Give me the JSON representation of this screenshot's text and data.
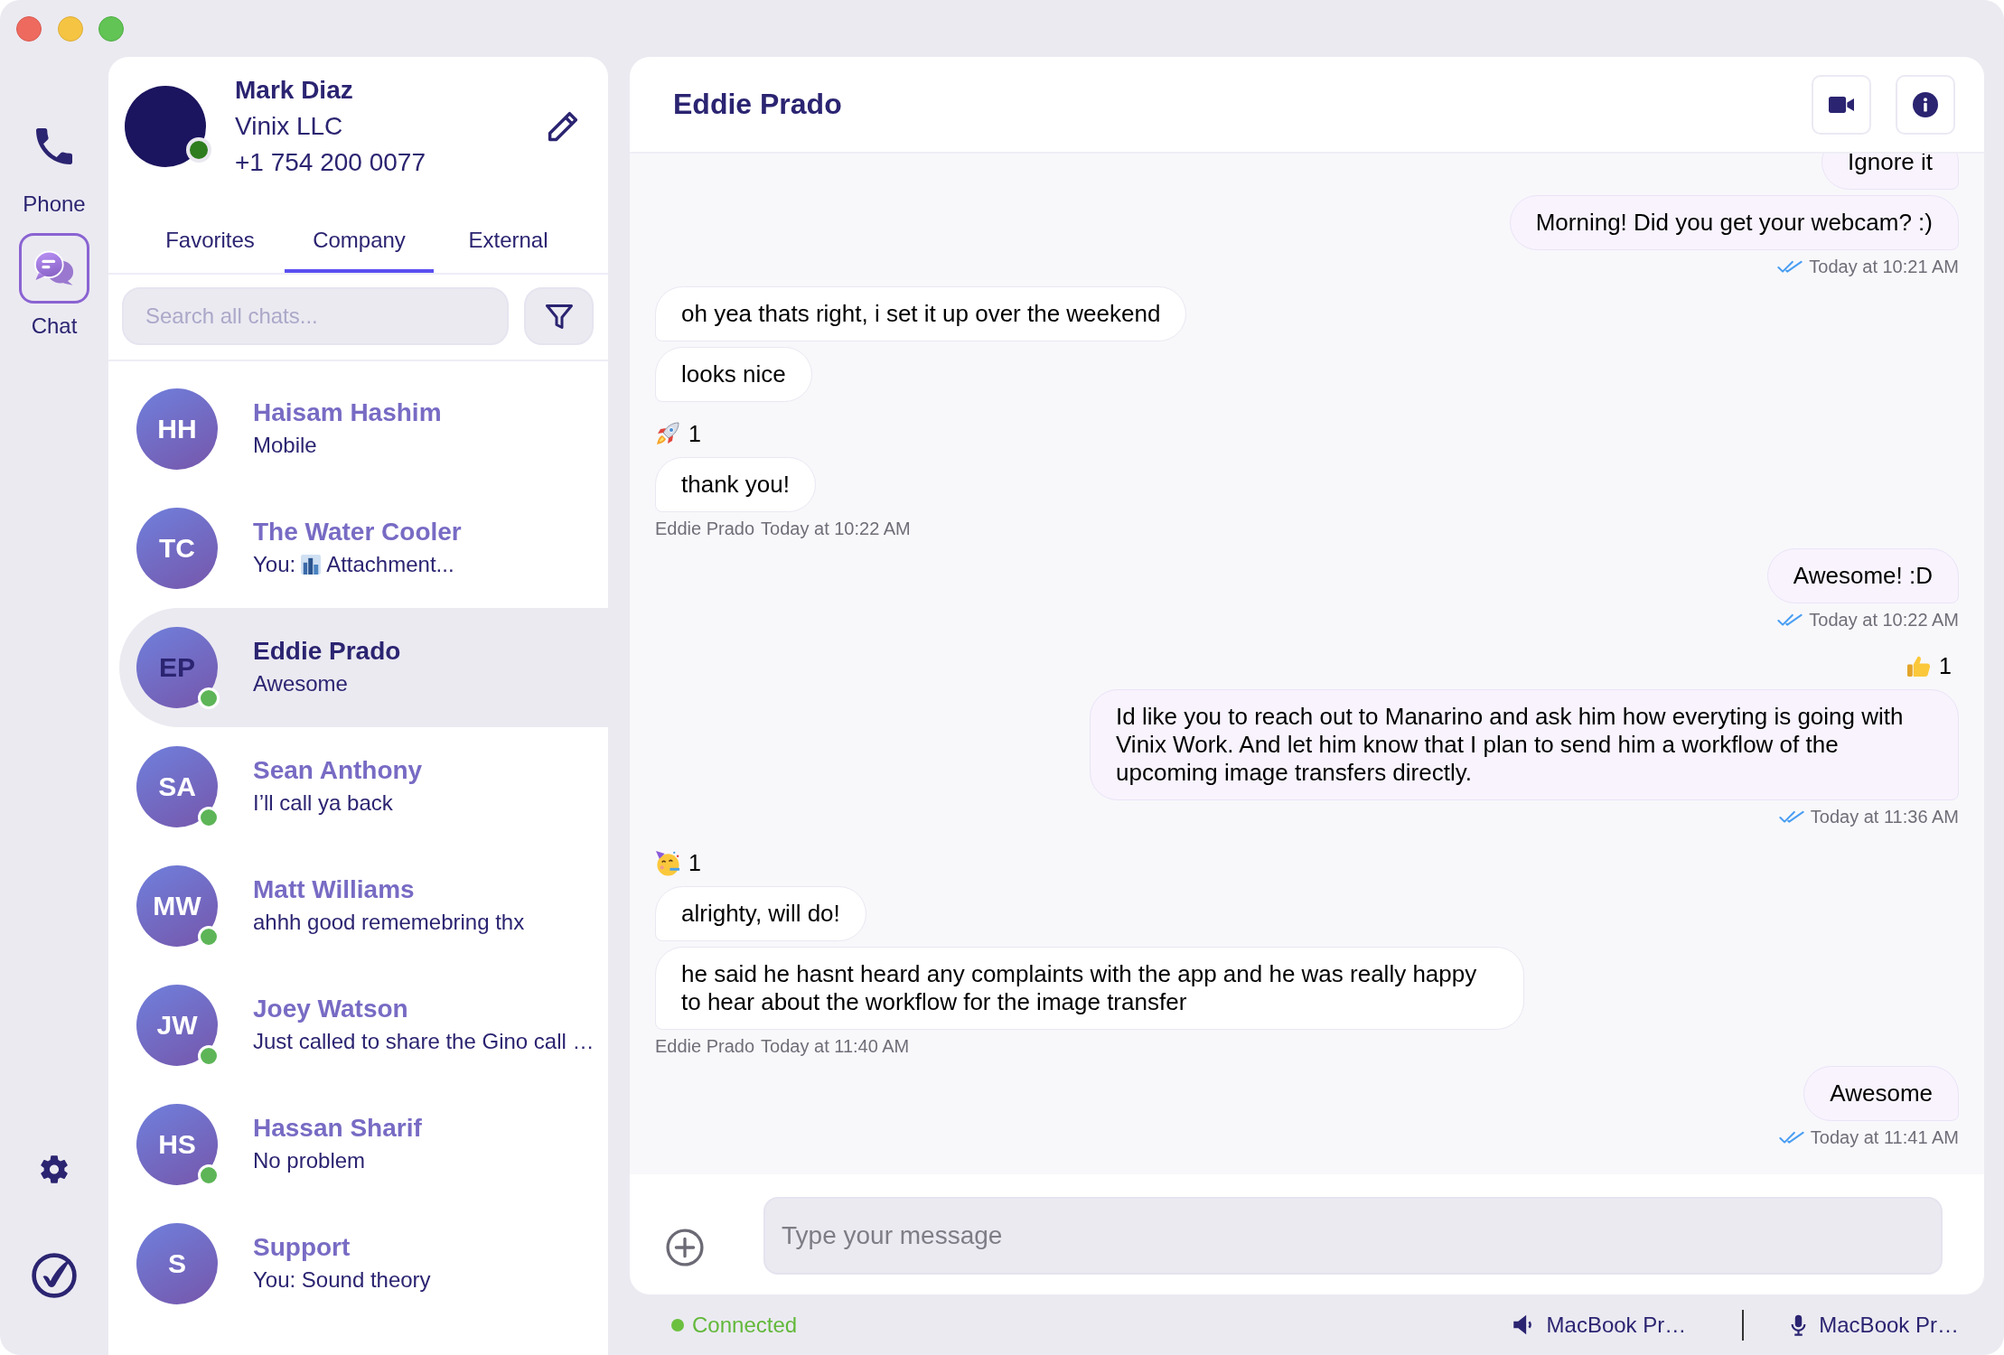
{
  "rail": {
    "items": [
      {
        "kind": "phone",
        "label": "Phone",
        "selected": false
      },
      {
        "kind": "chat",
        "label": "Chat",
        "selected": true
      }
    ]
  },
  "profile": {
    "name": "Mark Diaz",
    "company": "Vinix LLC",
    "phone": "+1 754 200 0077",
    "online": true
  },
  "tabs": [
    {
      "label": "Favorites",
      "selected": false
    },
    {
      "label": "Company",
      "selected": true
    },
    {
      "label": "External",
      "selected": false
    }
  ],
  "search": {
    "placeholder": "Search all chats..."
  },
  "chats": [
    {
      "initials": "HH",
      "name": "Haisam Hashim",
      "preview": "Mobile",
      "online": false,
      "selected": false
    },
    {
      "initials": "TC",
      "name": "The Water Cooler",
      "preview": "You:",
      "attachment": {
        "label": "Attachment..."
      },
      "online": false,
      "selected": false
    },
    {
      "initials": "EP",
      "name": "Eddie Prado",
      "preview": "Awesome",
      "online": true,
      "selected": true
    },
    {
      "initials": "SA",
      "name": "Sean Anthony",
      "preview": "I’ll call ya back",
      "online": true,
      "selected": false
    },
    {
      "initials": "MW",
      "name": "Matt Williams",
      "preview": "ahhh good rememebring thx",
      "online": true,
      "selected": false
    },
    {
      "initials": "JW",
      "name": "Joey Watson",
      "preview": "Just called to share the Gino call …",
      "online": true,
      "selected": false
    },
    {
      "initials": "HS",
      "name": "Hassan Sharif",
      "preview": "No problem",
      "online": true,
      "selected": false
    },
    {
      "initials": "S",
      "name": "Support",
      "preview": "You: Sound theory",
      "online": false,
      "selected": false
    }
  ],
  "conversation": {
    "title": "Eddie Prado",
    "messages": [
      {
        "kind": "outgoing",
        "bubbles": [
          {
            "text": "Ignore it"
          },
          {
            "text": "Morning! Did you get your webcam? :)"
          }
        ],
        "time": "Today at 10:21 AM",
        "read": true
      },
      {
        "kind": "incoming",
        "bubbles": [
          {
            "text": "oh yea thats right, i set it up over the weekend"
          },
          {
            "text": "looks nice"
          },
          {
            "text": "thank you!",
            "reaction": {
              "kind": "rocket",
              "count": "1"
            }
          }
        ],
        "sender": "Eddie Prado",
        "time": "Today at 10:22 AM"
      },
      {
        "kind": "outgoing",
        "bubbles": [
          {
            "text": "Awesome! :D"
          }
        ],
        "time": "Today at 10:22 AM",
        "read": true
      },
      {
        "kind": "outgoing",
        "bubbles": [
          {
            "text": "Id like you to reach out to Manarino and ask him how everyting is going with Vinix Work. And let him know that I plan to send him a workflow of the upcoming image transfers directly.",
            "reaction": {
              "kind": "thumbs_up",
              "count": "1"
            }
          }
        ],
        "time": "Today at 11:36 AM",
        "read": true
      },
      {
        "kind": "incoming",
        "bubbles": [
          {
            "text": "alrighty, will do!",
            "reaction": {
              "kind": "party",
              "count": "1"
            }
          },
          {
            "text": "he said he hasnt heard any complaints with the app and he was really happy to hear about the workflow for the image transfer"
          }
        ],
        "sender": "Eddie Prado",
        "time": "Today at 11:40 AM"
      },
      {
        "kind": "outgoing",
        "bubbles": [
          {
            "text": "Awesome"
          }
        ],
        "time": "Today at 11:41 AM",
        "read": true
      }
    ],
    "composer": {
      "placeholder": "Type your message"
    }
  },
  "status_bar": {
    "connection": "Connected",
    "connected": true,
    "speaker": "MacBook Pr…",
    "microphone": "MacBook Pr…"
  }
}
